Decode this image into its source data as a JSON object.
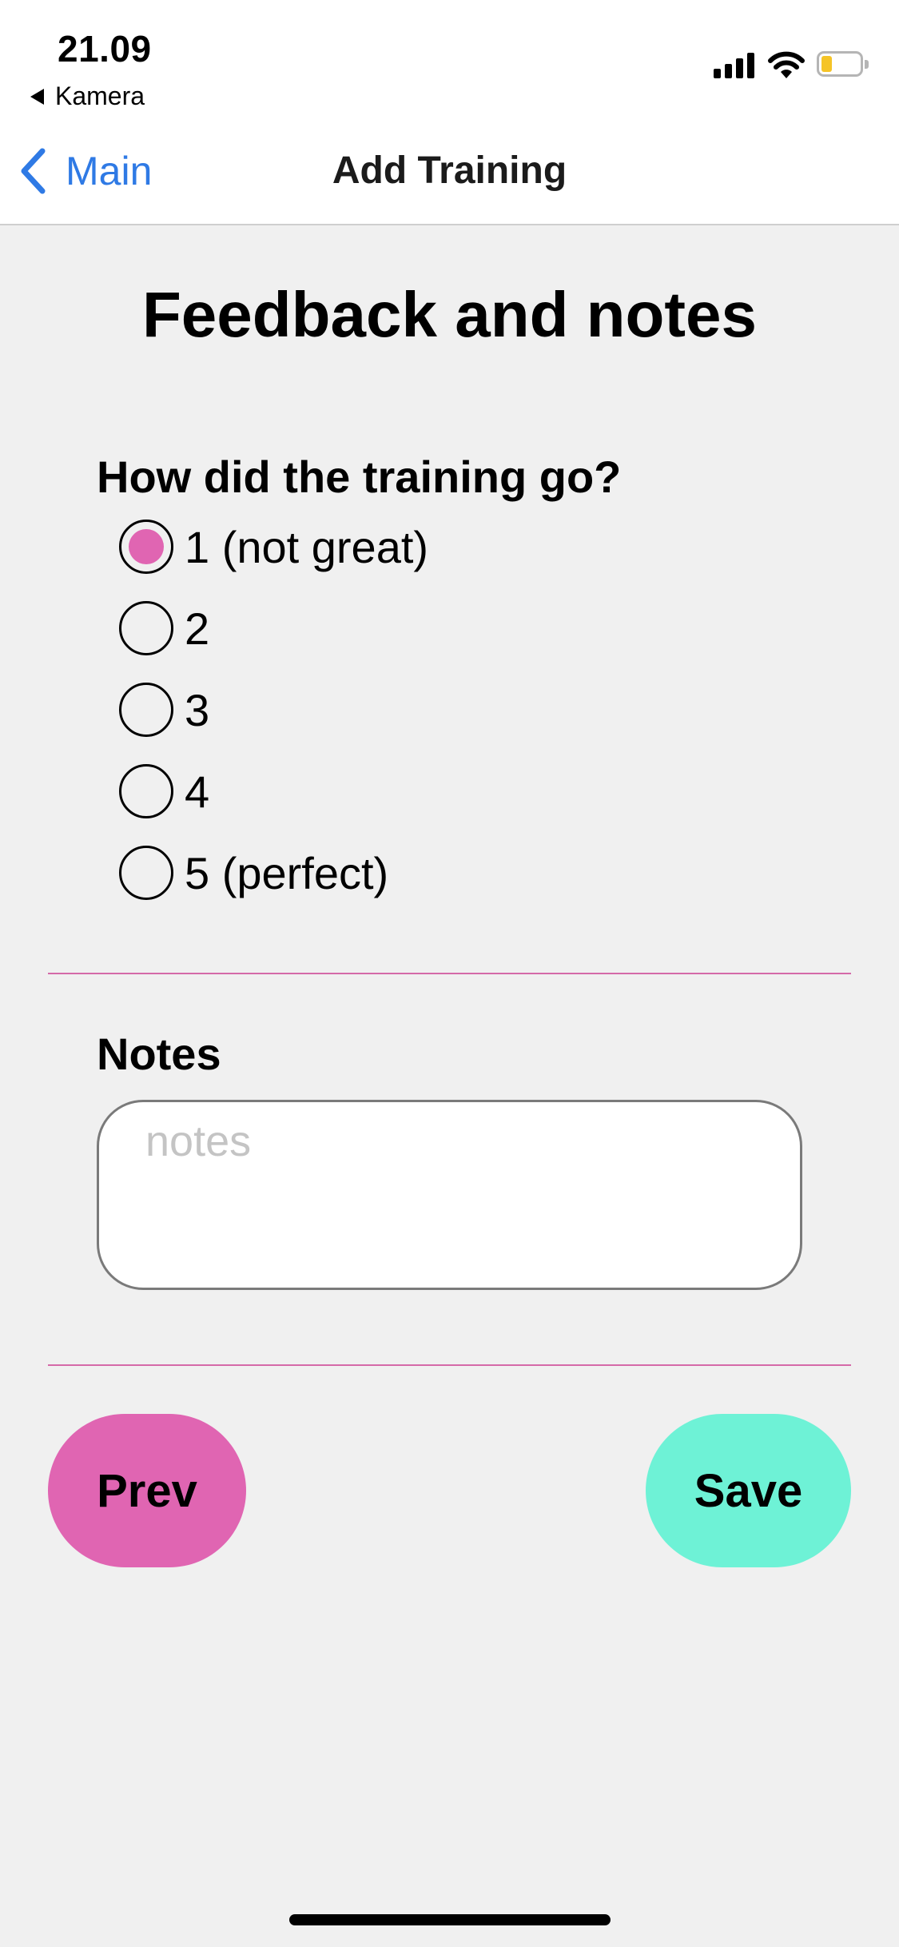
{
  "status_bar": {
    "time": "21.09",
    "back_app": "Kamera",
    "icons": [
      "cellular-signal-icon",
      "wifi-icon",
      "battery-icon"
    ],
    "battery_color": "#f5c427"
  },
  "nav": {
    "back_label": "Main",
    "back_icon": "chevron-left-icon",
    "title": "Add Training",
    "accent_color": "#2f7ae5"
  },
  "page": {
    "title": "Feedback and notes"
  },
  "rating": {
    "question": "How did the training go?",
    "options": [
      {
        "label": "1 (not great)",
        "selected": true
      },
      {
        "label": "2",
        "selected": false
      },
      {
        "label": "3",
        "selected": false
      },
      {
        "label": "4",
        "selected": false
      },
      {
        "label": "5 (perfect)",
        "selected": false
      }
    ],
    "selected_color": "#e065b2"
  },
  "notes": {
    "label": "Notes",
    "placeholder": "notes",
    "value": ""
  },
  "buttons": {
    "prev_label": "Prev",
    "prev_color": "#e065b2",
    "save_label": "Save",
    "save_color": "#6ef2d6"
  },
  "colors": {
    "background": "#f0f0f0",
    "divider": "#d56aa8"
  }
}
